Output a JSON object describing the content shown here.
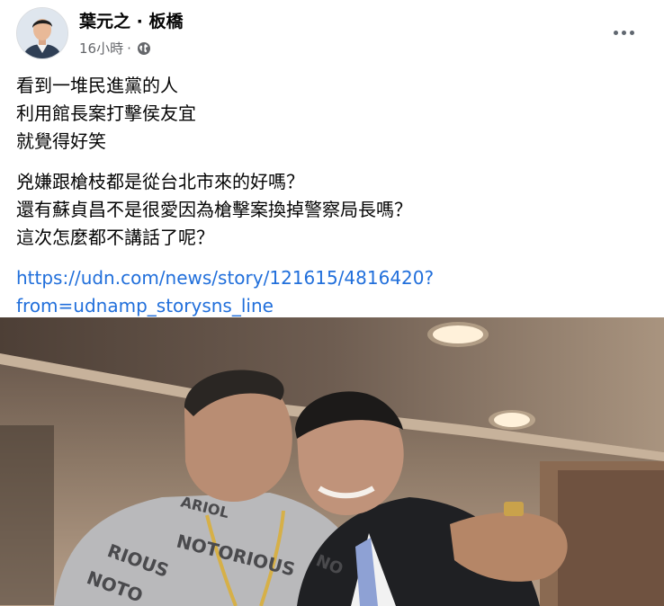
{
  "post": {
    "author": "葉元之 · 板橋",
    "time": "16小時",
    "privacy_icon": "globe-icon",
    "more_icon": "more-horizontal-icon",
    "paragraphs": [
      [
        "看到一堆民進黨的人",
        "利用館長案打擊侯友宜",
        "就覺得好笑"
      ],
      [
        "兇嫌跟槍枝都是從台北市來的好嗎？",
        "還有蘇貞昌不是很愛因為槍擊案換掉警察局長嗎？",
        "這次怎麼都不講話了呢？"
      ]
    ],
    "link_lines": [
      "https://udn.com/news/story/121615/4816420?",
      "from=udnamp_storysns_line"
    ],
    "photo_text": {
      "shirt_main": "NOTORIOUS",
      "shirt_left": "RIOUS",
      "shirt_bottom": "NOTO",
      "shirt_top": "ARIOL",
      "shirt_right": "NO"
    }
  },
  "colors": {
    "link": "#216fdb",
    "secondary_text": "#65676b",
    "primary_text": "#050505"
  }
}
